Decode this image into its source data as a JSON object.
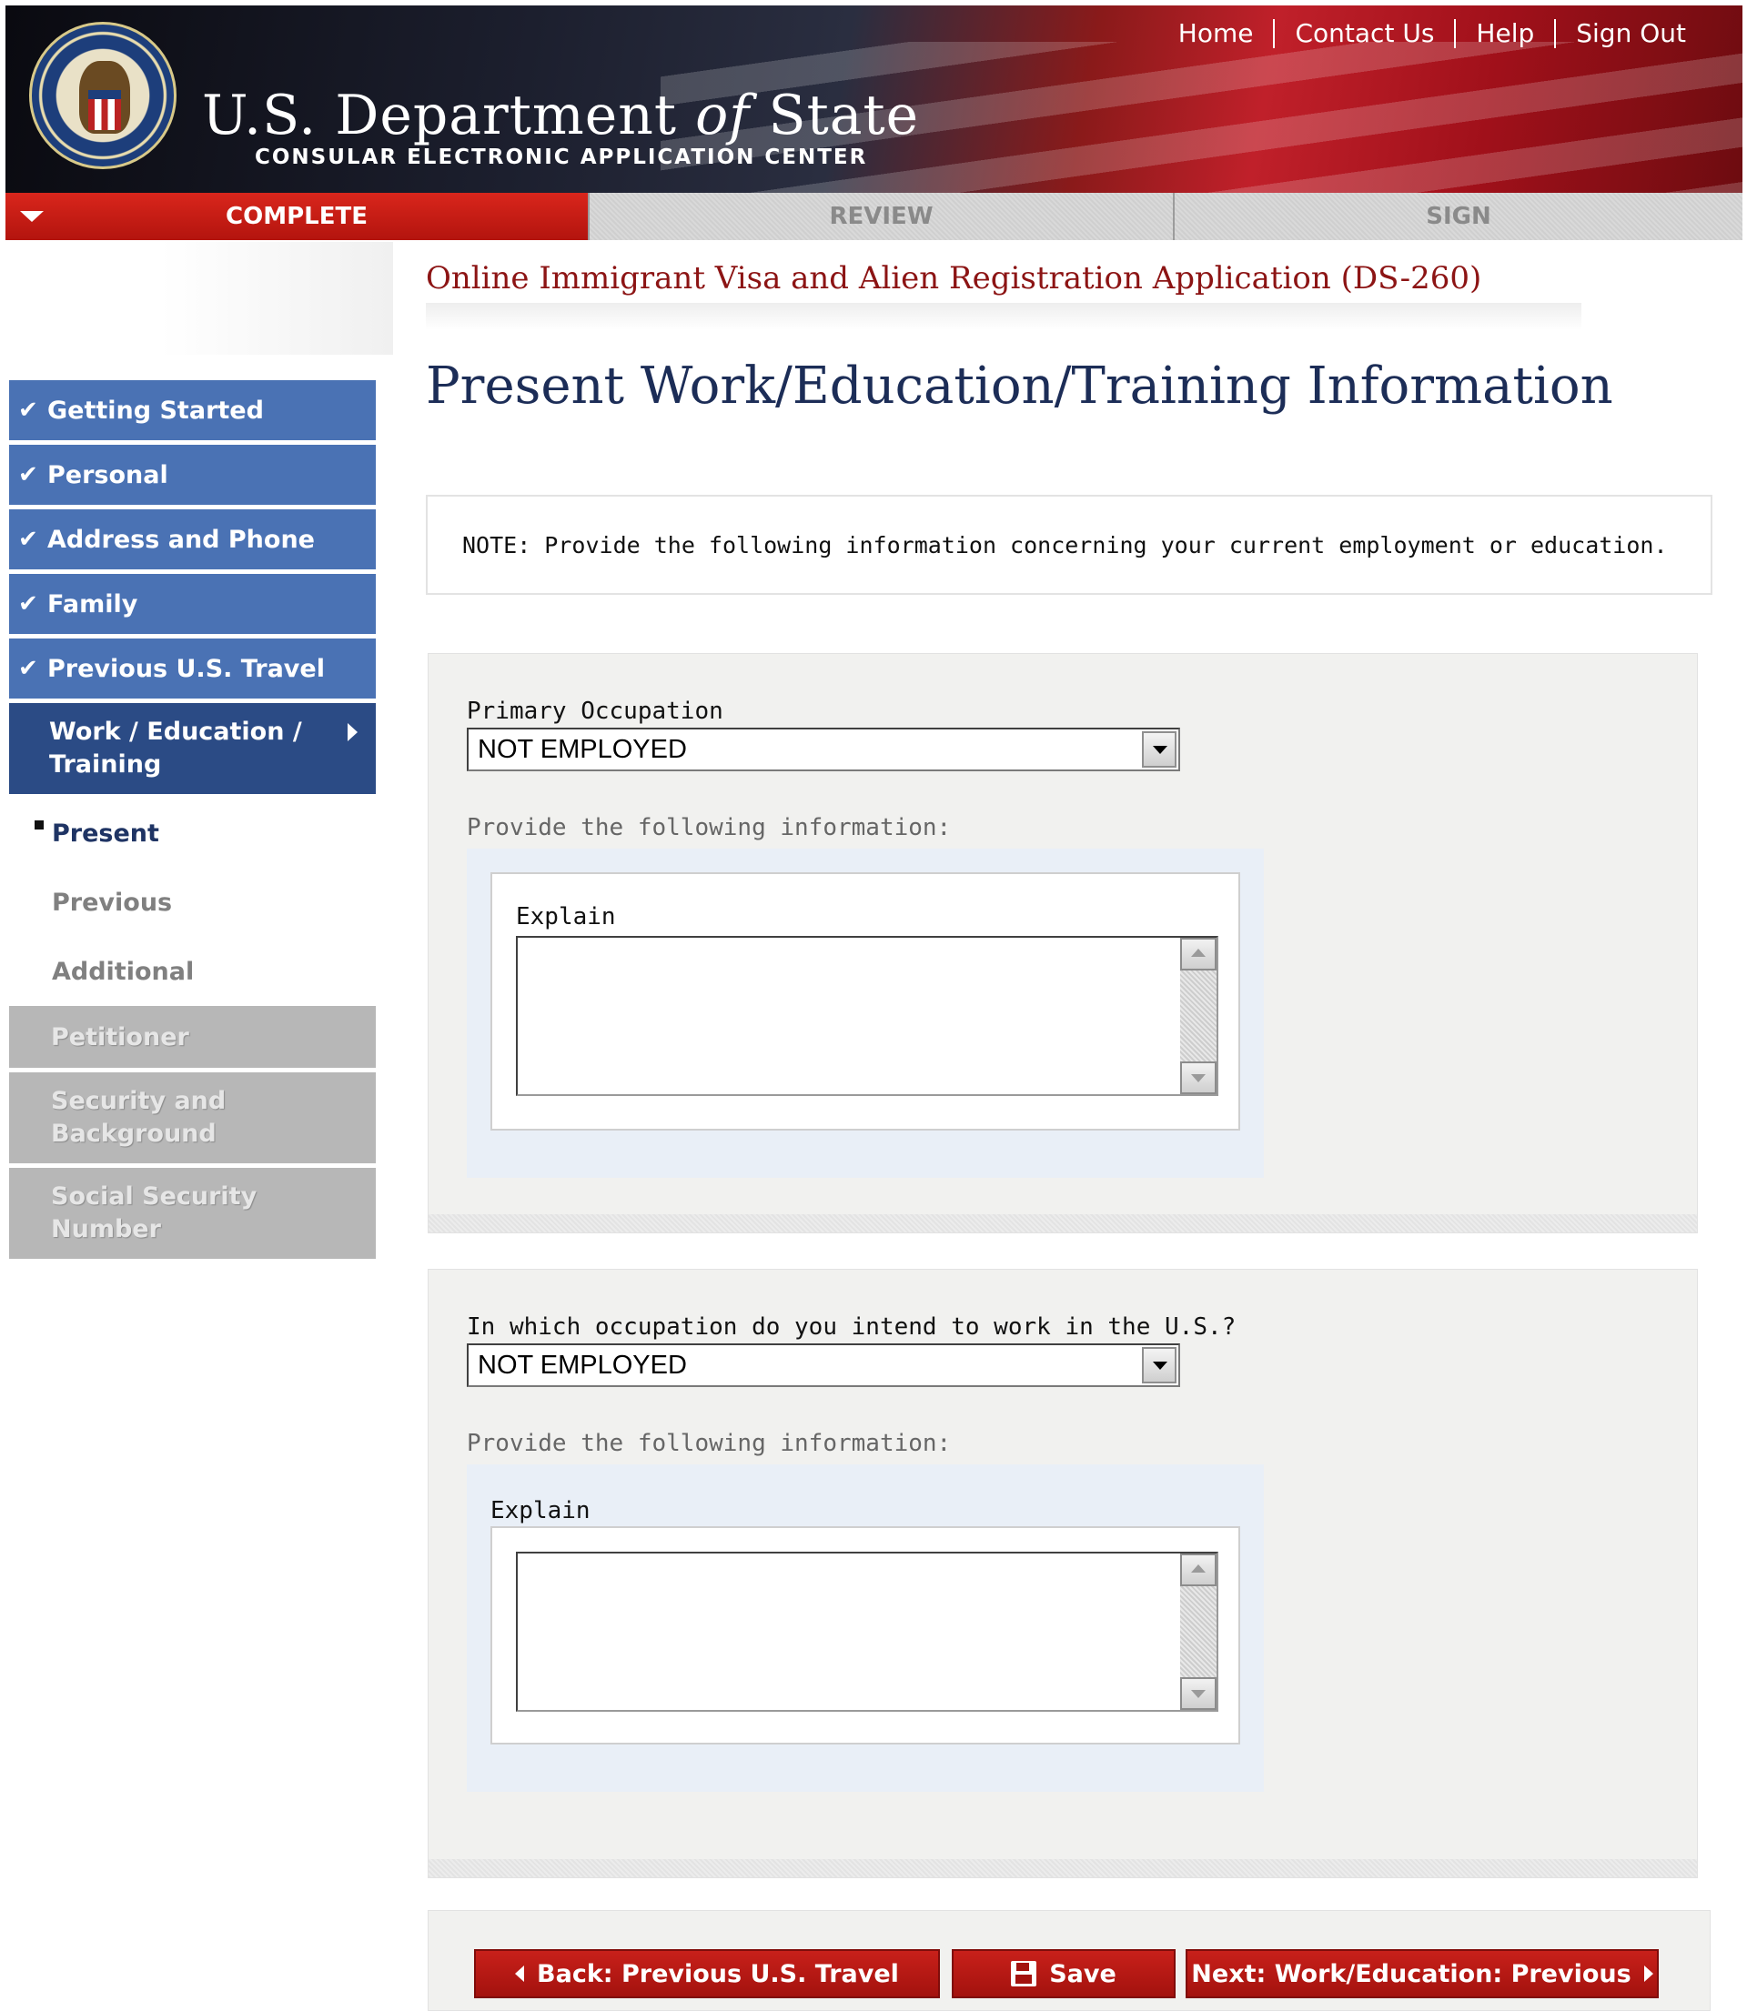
{
  "header": {
    "nav": [
      "Home",
      "Contact Us",
      "Help",
      "Sign Out"
    ],
    "title_part1": "U.S. Department ",
    "title_of": "of",
    "title_part2": " State",
    "subtitle": "CONSULAR ELECTRONIC APPLICATION CENTER"
  },
  "steps": {
    "complete": "COMPLETE",
    "review": "REVIEW",
    "sign": "SIGN"
  },
  "app_title": "Online Immigrant Visa and Alien Registration Application (DS-260)",
  "sidebar": {
    "done_items": [
      "Getting Started",
      "Personal",
      "Address and Phone",
      "Family",
      "Previous U.S. Travel"
    ],
    "current_line1": "Work / Education /",
    "current_line2": "Training",
    "sub_items": [
      "Present",
      "Previous",
      "Additional"
    ],
    "disabled": {
      "petitioner": "Petitioner",
      "security_l1": "Security and",
      "security_l2": "Background",
      "ssn_l1": "Social Security",
      "ssn_l2": "Number"
    }
  },
  "page_title": "Present Work/Education/Training Information",
  "note": "NOTE: Provide the following information concerning your current employment or education.",
  "section1": {
    "label": "Primary Occupation",
    "value": "NOT EMPLOYED",
    "provide": "Provide the following information:",
    "explain": "Explain"
  },
  "section2": {
    "label": "In which occupation do you intend to work in the U.S.?",
    "value": "NOT EMPLOYED",
    "provide": "Provide the following information:",
    "explain": "Explain"
  },
  "buttons": {
    "back": "Back: Previous U.S. Travel",
    "save": "Save",
    "next": "Next: Work/Education: Previous"
  },
  "colors": {
    "nav_blue": "#4a72b4",
    "nav_current": "#2b4b85",
    "accent_red": "#b3140e",
    "title_navy": "#1c2d57"
  }
}
